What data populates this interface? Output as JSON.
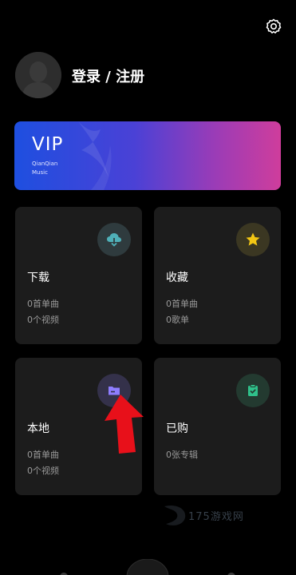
{
  "header": {
    "settings_icon": "gear-icon",
    "login_label": "登录 / 注册"
  },
  "vip": {
    "title": "VIP",
    "subtitle_line1": "QianQian",
    "subtitle_line2": "Music",
    "colors": [
      "#1e4fe0",
      "#cf3d9c"
    ]
  },
  "tiles": [
    {
      "title": "下载",
      "lines": [
        "0首单曲",
        "0个视频"
      ],
      "icon": "cloud-download-icon",
      "icon_color": "#4fb0b8",
      "icon_bg": "#2f3b3e"
    },
    {
      "title": "收藏",
      "lines": [
        "0首单曲",
        "0歌单"
      ],
      "icon": "star-icon",
      "icon_color": "#f2c614",
      "icon_bg": "#3b3722"
    },
    {
      "title": "本地",
      "lines": [
        "0首单曲",
        "0个视频"
      ],
      "icon": "folder-icon",
      "icon_color": "#8e7dff",
      "icon_bg": "#34314a"
    },
    {
      "title": "已购",
      "lines": [
        "0张专辑"
      ],
      "icon": "bag-check-icon",
      "icon_color": "#2fc08a",
      "icon_bg": "#233a30"
    }
  ],
  "annotation": {
    "arrow_color": "#e8101a"
  },
  "watermark": {
    "text": "175游戏网"
  }
}
